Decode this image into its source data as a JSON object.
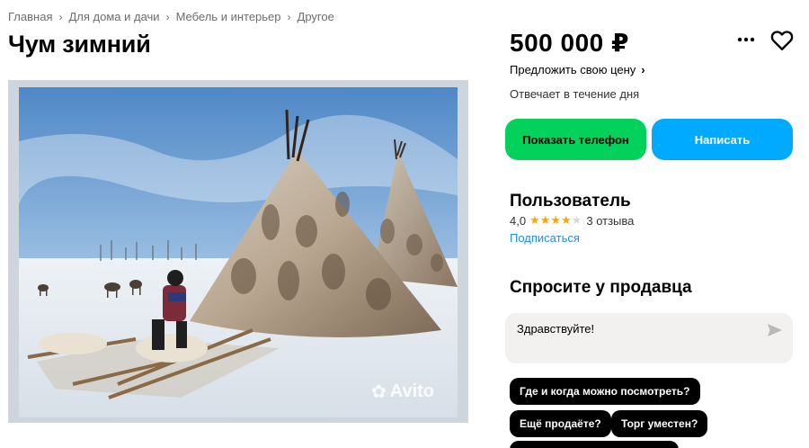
{
  "breadcrumb": [
    "Главная",
    "Для дома и дачи",
    "Мебель и интерьер",
    "Другое"
  ],
  "listing": {
    "title": "Чум зимний",
    "watermark": "Avito"
  },
  "sidebar": {
    "price": "500 000 ₽",
    "offer_price": "Предложить свою цену",
    "responds": "Отвечает в течение дня",
    "show_phone": "Показать телефон",
    "write": "Написать"
  },
  "seller": {
    "name": "Пользователь",
    "rating": "4,0",
    "rating_stars": 4,
    "reviews": "3 отзыва",
    "subscribe": "Подписаться"
  },
  "ask": {
    "title": "Спросите у продавца",
    "message": "Здравствуйте!",
    "quick_questions": [
      "Где и когда можно посмотреть?",
      "Ещё продаёте?",
      "Торг уместен?",
      ""
    ]
  },
  "colors": {
    "phone_button": "#02d15c",
    "write_button": "#00aaff",
    "link": "#1a8cff",
    "star": "#ffa500"
  },
  "icons": [
    "chevron-right-icon",
    "more-icon",
    "heart-icon",
    "send-icon",
    "star-icon"
  ]
}
